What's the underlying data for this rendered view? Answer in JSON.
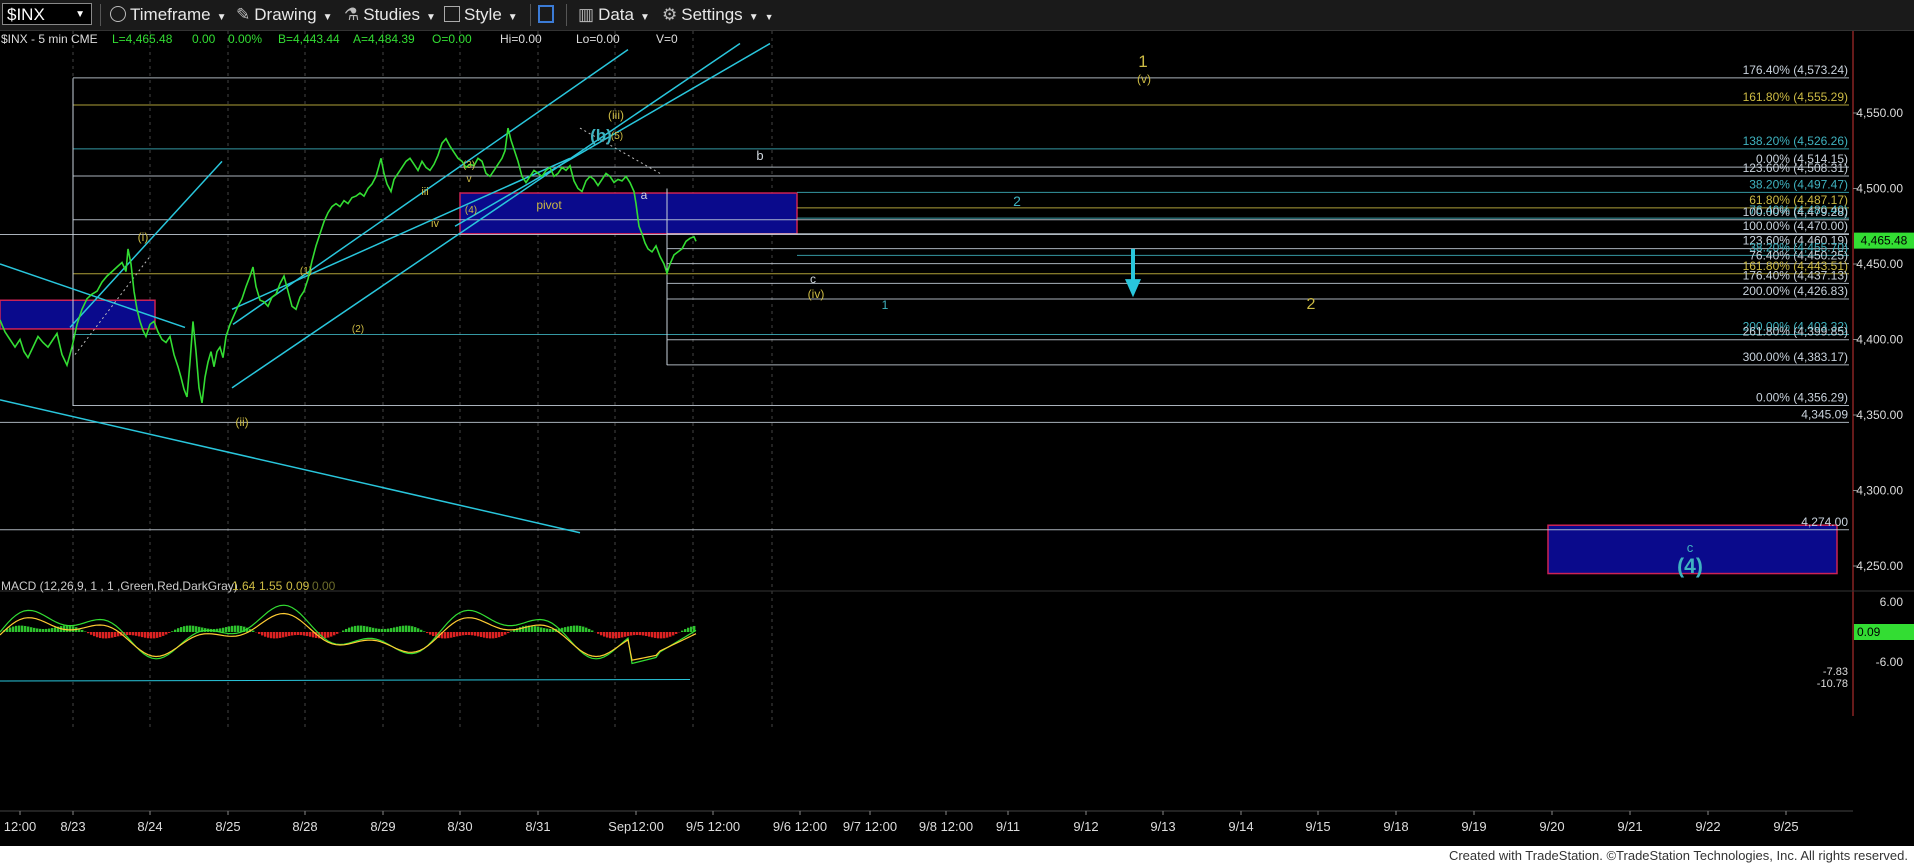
{
  "toolbar": {
    "symbol": "$INX",
    "timeframe": "Timeframe",
    "drawing": "Drawing",
    "studies": "Studies",
    "style": "Style",
    "data": "Data",
    "settings": "Settings"
  },
  "header": {
    "symbol": "$INX - 5 min  CME",
    "last": "L=4,465.48",
    "change": "0.00",
    "pct": "0.00%",
    "bid": "B=4,443.44",
    "ask": "A=4,484.39",
    "o": "O=0.00",
    "hi": "Hi=0.00",
    "lo": "Lo=0.00",
    "v": "V=0"
  },
  "colors": {
    "price": "#33dd33",
    "fib_white": "#c8d2dc",
    "fib_yellow": "#cdbb44",
    "fib_teal": "#3fb3c0",
    "channel": "#29c6dc",
    "box_fill": "#0a0a8c",
    "box_border": "#cc2255",
    "last_price": "#33dd33",
    "macd_fast": "#33dd33",
    "macd_slow": "#ffcc33",
    "hist_up": "#2ec22e",
    "hist_down": "#dd2222"
  },
  "chart_data": [
    {
      "type": "line",
      "title": "$INX - 5 min",
      "x_ticks": [
        "12:00",
        "8/23",
        "8/24",
        "8/25",
        "8/28",
        "8/29",
        "8/30",
        "8/31",
        "Sep12:00",
        "9/5 12:00",
        "9/6 12:00",
        "9/7 12:00",
        "9/8 12:00",
        "9/11",
        "9/12",
        "9/13",
        "9/14",
        "9/15",
        "9/18",
        "9/19",
        "9/20",
        "9/21",
        "9/22",
        "9/25"
      ],
      "y_ticks": [
        "4,550.00",
        "4,500.00",
        "4,450.00",
        "4,400.00",
        "4,350.00",
        "4,300.00",
        "4,250.00"
      ],
      "ylim": [
        4232,
        4596
      ],
      "last_price": "4,465.48",
      "series": [
        {
          "points": [
            [
              0,
              4413
            ],
            [
              5,
              4405
            ],
            [
              10,
              4400
            ],
            [
              15,
              4395
            ],
            [
              20,
              4400
            ],
            [
              24,
              4392
            ],
            [
              28,
              4388
            ],
            [
              33,
              4395
            ],
            [
              38,
              4402
            ],
            [
              43,
              4398
            ],
            [
              48,
              4395
            ],
            [
              53,
              4400
            ],
            [
              57,
              4404
            ],
            [
              62,
              4390
            ],
            [
              67,
              4383
            ],
            [
              72,
              4395
            ],
            [
              77,
              4410
            ],
            [
              82,
              4420
            ],
            [
              87,
              4427
            ],
            [
              92,
              4430
            ],
            [
              97,
              4432
            ],
            [
              102,
              4438
            ],
            [
              107,
              4442
            ],
            [
              112,
              4445
            ],
            [
              117,
              4448
            ],
            [
              122,
              4451
            ],
            [
              126,
              4445
            ],
            [
              128,
              4460
            ],
            [
              131,
              4450
            ],
            [
              134,
              4432
            ],
            [
              137,
              4420
            ],
            [
              140,
              4412
            ],
            [
              143,
              4406
            ],
            [
              146,
              4402
            ],
            [
              150,
              4410
            ],
            [
              154,
              4412
            ],
            [
              158,
              4405
            ],
            [
              162,
              4400
            ],
            [
              166,
              4398
            ],
            [
              170,
              4402
            ],
            [
              174,
              4390
            ],
            [
              178,
              4382
            ],
            [
              181,
              4375
            ],
            [
              184,
              4367
            ],
            [
              187,
              4362
            ],
            [
              190,
              4385
            ],
            [
              193,
              4412
            ],
            [
              196,
              4392
            ],
            [
              199,
              4368
            ],
            [
              202,
              4358
            ],
            [
              205,
              4375
            ],
            [
              208,
              4385
            ],
            [
              211,
              4392
            ],
            [
              214,
              4382
            ],
            [
              217,
              4392
            ],
            [
              220,
              4395
            ],
            [
              223,
              4388
            ],
            [
              226,
              4402
            ],
            [
              230,
              4410
            ],
            [
              234,
              4416
            ],
            [
              238,
              4422
            ],
            [
              242,
              4427
            ],
            [
              246,
              4435
            ],
            [
              250,
              4442
            ],
            [
              253,
              4448
            ],
            [
              256,
              4435
            ],
            [
              260,
              4426
            ],
            [
              264,
              4425
            ],
            [
              268,
              4422
            ],
            [
              272,
              4428
            ],
            [
              276,
              4430
            ],
            [
              280,
              4437
            ],
            [
              284,
              4442
            ],
            [
              288,
              4432
            ],
            [
              292,
              4422
            ],
            [
              296,
              4420
            ],
            [
              300,
              4428
            ],
            [
              304,
              4432
            ],
            [
              308,
              4440
            ],
            [
              312,
              4452
            ],
            [
              316,
              4462
            ],
            [
              320,
              4470
            ],
            [
              324,
              4478
            ],
            [
              328,
              4484
            ],
            [
              332,
              4488
            ],
            [
              336,
              4490
            ],
            [
              340,
              4488
            ],
            [
              344,
              4492
            ],
            [
              348,
              4490
            ],
            [
              352,
              4494
            ],
            [
              356,
              4495
            ],
            [
              360,
              4497
            ],
            [
              364,
              4495
            ],
            [
              368,
              4500
            ],
            [
              372,
              4503
            ],
            [
              376,
              4508
            ],
            [
              379,
              4515
            ],
            [
              381,
              4520
            ],
            [
              384,
              4510
            ],
            [
              387,
              4503
            ],
            [
              391,
              4498
            ],
            [
              394,
              4506
            ],
            [
              398,
              4510
            ],
            [
              402,
              4514
            ],
            [
              406,
              4518
            ],
            [
              410,
              4520
            ],
            [
              414,
              4516
            ],
            [
              418,
              4512
            ],
            [
              422,
              4518
            ],
            [
              426,
              4514
            ],
            [
              430,
              4512
            ],
            [
              434,
              4516
            ],
            [
              438,
              4522
            ],
            [
              442,
              4530
            ],
            [
              446,
              4533
            ],
            [
              450,
              4528
            ],
            [
              454,
              4524
            ],
            [
              458,
              4520
            ],
            [
              462,
              4518
            ],
            [
              466,
              4514
            ],
            [
              470,
              4516
            ],
            [
              474,
              4515
            ],
            [
              478,
              4520
            ],
            [
              482,
              4518
            ],
            [
              486,
              4510
            ],
            [
              490,
              4508
            ],
            [
              494,
              4512
            ],
            [
              498,
              4516
            ],
            [
              502,
              4520
            ],
            [
              505,
              4525
            ],
            [
              508,
              4540
            ],
            [
              511,
              4532
            ],
            [
              514,
              4526
            ],
            [
              518,
              4518
            ],
            [
              522,
              4508
            ],
            [
              526,
              4504
            ],
            [
              530,
              4508
            ],
            [
              534,
              4512
            ],
            [
              538,
              4510
            ],
            [
              542,
              4508
            ],
            [
              546,
              4512
            ],
            [
              550,
              4514
            ],
            [
              554,
              4508
            ],
            [
              558,
              4510
            ],
            [
              562,
              4514
            ],
            [
              566,
              4512
            ],
            [
              570,
              4515
            ],
            [
              574,
              4505
            ],
            [
              578,
              4500
            ],
            [
              582,
              4498
            ],
            [
              586,
              4505
            ],
            [
              590,
              4508
            ],
            [
              594,
              4506
            ],
            [
              598,
              4502
            ],
            [
              602,
              4506
            ],
            [
              606,
              4510
            ],
            [
              610,
              4508
            ],
            [
              614,
              4504
            ],
            [
              618,
              4506
            ],
            [
              622,
              4505
            ],
            [
              626,
              4508
            ],
            [
              630,
              4504
            ],
            [
              634,
              4498
            ],
            [
              636,
              4490
            ],
            [
              639,
              4475
            ],
            [
              642,
              4470
            ],
            [
              645,
              4464
            ],
            [
              648,
              4460
            ],
            [
              652,
              4458
            ],
            [
              656,
              4462
            ],
            [
              660,
              4455
            ],
            [
              664,
              4450
            ],
            [
              667,
              4444
            ],
            [
              670,
              4450
            ],
            [
              674,
              4456
            ],
            [
              678,
              4458
            ],
            [
              682,
              4460
            ],
            [
              686,
              4465
            ],
            [
              690,
              4467
            ],
            [
              694,
              4468
            ],
            [
              696,
              4465
            ]
          ]
        }
      ],
      "fib_levels": [
        {
          "label": "176.40% (4,573.24)",
          "value": 4573.24,
          "color": "white"
        },
        {
          "label": "161.80% (4,555.29)",
          "value": 4555.29,
          "color": "yellow"
        },
        {
          "label": "138.20% (4,526.26)",
          "value": 4526.26,
          "color": "teal"
        },
        {
          "label": "0.00% (4,514.15)",
          "value": 4514.15,
          "color": "white"
        },
        {
          "label": "123.60% (4,508.31)",
          "value": 4508.31,
          "color": "white"
        },
        {
          "label": "38.20% (4,497.47)",
          "value": 4497.47,
          "color": "teal"
        },
        {
          "label": "61.80% (4,487.17)",
          "value": 4487.17,
          "color": "yellow"
        },
        {
          "label": "76.40% (4,480.40)",
          "value": 4480.4,
          "color": "teal"
        },
        {
          "label": "100.00% (4,479.28)",
          "value": 4479.28,
          "color": "white"
        },
        {
          "label": "100.00% (4,470.00)",
          "value": 4470.0,
          "color": "white"
        },
        {
          "label": "4,470.00",
          "value": 4469.5,
          "color": "white"
        },
        {
          "label": "123.60% (4,460.19)",
          "value": 4460.19,
          "color": "white"
        },
        {
          "label": "38.20% (4,455.70)",
          "value": 4455.7,
          "color": "teal"
        },
        {
          "label": "76.40% (4,450.25)",
          "value": 4450.25,
          "color": "white"
        },
        {
          "label": "161.80% (4,443.51)",
          "value": 4443.51,
          "color": "yellow"
        },
        {
          "label": "176.40% (4,437.13)",
          "value": 4437.13,
          "color": "white"
        },
        {
          "label": "200.00% (4,426.83)",
          "value": 4426.83,
          "color": "white"
        },
        {
          "label": "200.00% (4,403.32)",
          "value": 4403.32,
          "color": "teal"
        },
        {
          "label": "261.80% (4,399.85)",
          "value": 4399.85,
          "color": "white"
        },
        {
          "label": "300.00% (4,383.17)",
          "value": 4383.17,
          "color": "white"
        },
        {
          "label": "0.00% (4,356.29)",
          "value": 4356.29,
          "color": "white"
        },
        {
          "label": "4,345.09",
          "value": 4345.09,
          "color": "white"
        },
        {
          "label": "4,274.00",
          "value": 4274.0,
          "color": "white"
        }
      ],
      "annotations": [
        {
          "text": "1",
          "color": "yellow"
        },
        {
          "text": "(v)",
          "color": "yellow"
        },
        {
          "text": "(iii)",
          "color": "yellow"
        },
        {
          "text": "(b)",
          "color": "teal"
        },
        {
          "text": "(5)",
          "color": "yellow"
        },
        {
          "text": "(3)",
          "color": "yellow"
        },
        {
          "text": "v",
          "color": "yellow"
        },
        {
          "text": "iii",
          "color": "yellow"
        },
        {
          "text": "iv",
          "color": "yellow"
        },
        {
          "text": "(4)",
          "color": "yellow"
        },
        {
          "text": "pivot",
          "color": "yellow"
        },
        {
          "text": "a",
          "color": "white"
        },
        {
          "text": "b",
          "color": "white"
        },
        {
          "text": "c",
          "color": "white"
        },
        {
          "text": "(iv)",
          "color": "yellow"
        },
        {
          "text": "2",
          "color": "teal"
        },
        {
          "text": "1",
          "color": "teal"
        },
        {
          "text": "2",
          "color": "yellow"
        },
        {
          "text": "(i)",
          "color": "yellow"
        },
        {
          "text": "(ii)",
          "color": "yellow"
        },
        {
          "text": "(1)",
          "color": "yellow"
        },
        {
          "text": "(2)",
          "color": "yellow"
        },
        {
          "text": "c",
          "color": "teal"
        },
        {
          "text": "(4)",
          "color": "teal"
        }
      ]
    },
    {
      "type": "line",
      "title": "MACD (12,26,9, 1 , 1 ,Green,Red,DarkGray)",
      "values_text": [
        "1.64",
        "1.55",
        "0.09",
        "0.00"
      ],
      "y_ticks": [
        "6.00",
        "-6.00"
      ],
      "right_labels": [
        "0.09",
        "-7.83",
        "-10.78"
      ],
      "ylim": [
        -9,
        9
      ]
    }
  ],
  "footer": "Created with TradeStation. ©TradeStation Technologies, Inc. All rights reserved."
}
